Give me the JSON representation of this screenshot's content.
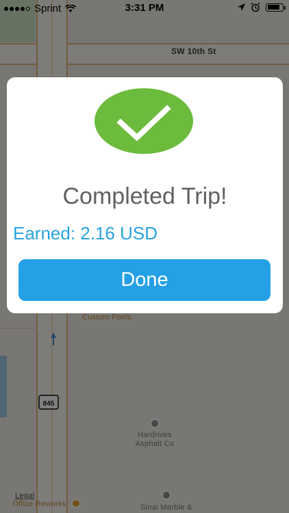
{
  "status_bar": {
    "carrier": "Sprint",
    "time": "3:31 PM",
    "signal_dots": 4,
    "icons": [
      "wifi-icon",
      "location-arrow-icon",
      "alarm-icon",
      "battery-icon"
    ],
    "battery_level": 0.85
  },
  "map": {
    "street_label": "SW 10th St",
    "route_number": "845",
    "pois": [
      {
        "name": "Custom Pools"
      },
      {
        "name_line1": "Hardrives",
        "name_line2": "Asphalt Co"
      },
      {
        "name": "Sinai Marble &"
      },
      {
        "name": "Office Reworks"
      }
    ],
    "legal_label": "Legal"
  },
  "modal": {
    "icon": "checkmark-icon",
    "title": "Completed Trip!",
    "earned_text": "Earned: 2.16 USD",
    "done_label": "Done"
  },
  "colors": {
    "check_green": "#6cbb3c",
    "accent_blue": "#29a3e0",
    "button_blue": "#25a0e6",
    "title_gray": "#606060"
  }
}
